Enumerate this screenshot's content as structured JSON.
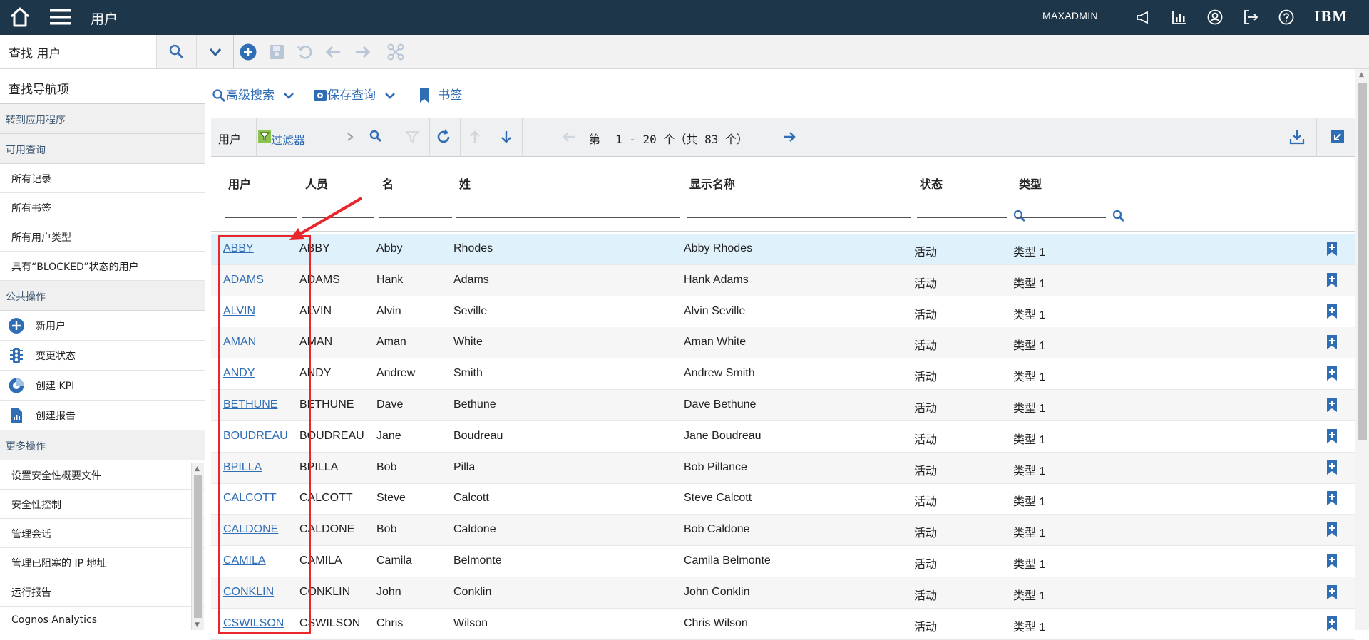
{
  "header": {
    "title": "用户",
    "user": "MAXADMIN",
    "brand": "IBM"
  },
  "toolbar": {
    "find_label": "查找 用户"
  },
  "sidebar": {
    "heading": "查找导航项",
    "section_goto": "转到应用程序",
    "section_queries": "可用查询",
    "queries": [
      "所有记录",
      "所有书签",
      "所有用户类型",
      "具有“BLOCKED”状态的用户"
    ],
    "section_common": "公共操作",
    "common_actions": [
      "新用户",
      "变更状态",
      "创建 KPI",
      "创建报告"
    ],
    "section_more": "更多操作",
    "more_actions": [
      "设置安全性概要文件",
      "安全性控制",
      "管理会话",
      "管理已阻塞的 IP 地址",
      "运行报告",
      "Cognos Analytics"
    ]
  },
  "actions": {
    "advanced_search": "高级搜索",
    "save_query": "保存查询",
    "bookmarks": "书签"
  },
  "filterbar": {
    "label": "用户",
    "filter": "过滤器",
    "page_prefix": "第",
    "page_range": "1 - 20 个（共 83 个）"
  },
  "table": {
    "columns": [
      "用户",
      "人员",
      "名",
      "姓",
      "显示名称",
      "状态",
      "类型"
    ],
    "rows": [
      {
        "user": "ABBY",
        "person": "ABBY",
        "first": "Abby",
        "last": "Rhodes",
        "display": "Abby Rhodes",
        "status": "活动",
        "type": "类型 1"
      },
      {
        "user": "ADAMS",
        "person": "ADAMS",
        "first": "Hank",
        "last": "Adams",
        "display": "Hank Adams",
        "status": "活动",
        "type": "类型 1"
      },
      {
        "user": "ALVIN",
        "person": "ALVIN",
        "first": "Alvin",
        "last": "Seville",
        "display": "Alvin Seville",
        "status": "活动",
        "type": "类型 1"
      },
      {
        "user": "AMAN",
        "person": "AMAN",
        "first": "Aman",
        "last": "White",
        "display": "Aman White",
        "status": "活动",
        "type": "类型 1"
      },
      {
        "user": "ANDY",
        "person": "ANDY",
        "first": "Andrew",
        "last": "Smith",
        "display": "Andrew Smith",
        "status": "活动",
        "type": "类型 1"
      },
      {
        "user": "BETHUNE",
        "person": "BETHUNE",
        "first": "Dave",
        "last": "Bethune",
        "display": "Dave Bethune",
        "status": "活动",
        "type": "类型 1"
      },
      {
        "user": "BOUDREAU",
        "person": "BOUDREAU",
        "first": "Jane",
        "last": "Boudreau",
        "display": "Jane Boudreau",
        "status": "活动",
        "type": "类型 1"
      },
      {
        "user": "BPILLA",
        "person": "BPILLA",
        "first": "Bob",
        "last": "Pilla",
        "display": "Bob Pillance",
        "status": "活动",
        "type": "类型 1"
      },
      {
        "user": "CALCOTT",
        "person": "CALCOTT",
        "first": "Steve",
        "last": "Calcott",
        "display": "Steve Calcott",
        "status": "活动",
        "type": "类型 1"
      },
      {
        "user": "CALDONE",
        "person": "CALDONE",
        "first": "Bob",
        "last": "Caldone",
        "display": "Bob Caldone",
        "status": "活动",
        "type": "类型 1"
      },
      {
        "user": "CAMILA",
        "person": "CAMILA",
        "first": "Camila",
        "last": "Belmonte",
        "display": "Camila Belmonte",
        "status": "活动",
        "type": "类型 1"
      },
      {
        "user": "CONKLIN",
        "person": "CONKLIN",
        "first": "John",
        "last": "Conklin",
        "display": "John Conklin",
        "status": "活动",
        "type": "类型 1"
      },
      {
        "user": "CSWILSON",
        "person": "CSWILSON",
        "first": "Chris",
        "last": "Wilson",
        "display": "Chris Wilson",
        "status": "活动",
        "type": "类型 1"
      }
    ]
  },
  "colors": {
    "header_bg": "#1d3649",
    "link": "#2f6db5",
    "selected_row": "#dff1fb",
    "annotation": "#e8262b"
  }
}
